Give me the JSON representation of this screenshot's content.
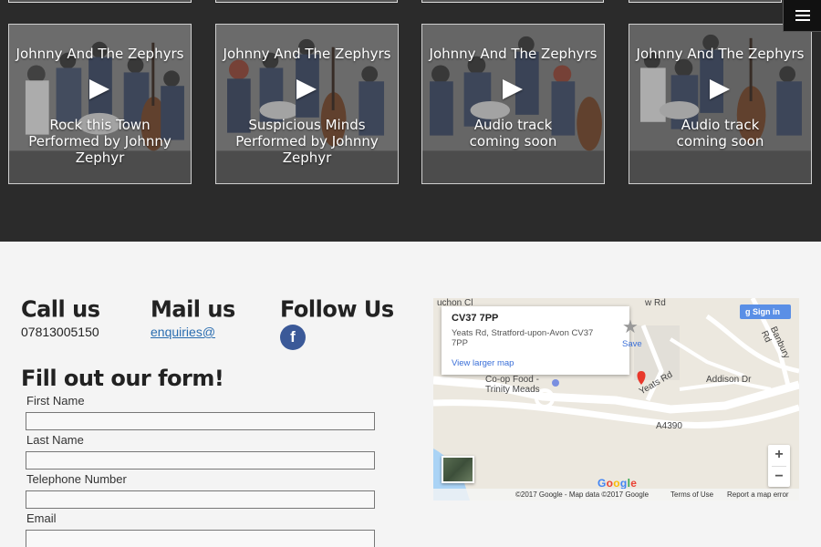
{
  "menu": {
    "icon": "hamburger-icon"
  },
  "tracks": [
    {
      "band": "Johnny And The Zephyrs",
      "caption": "Rock this Town Performed by Johnny Zephyr",
      "icon": "play-icon"
    },
    {
      "band": "Johnny And The Zephyrs",
      "caption": "Suspicious Minds Performed by Johnny Zephyr",
      "icon": "play-icon"
    },
    {
      "band": "Johnny And The Zephyrs",
      "caption": "Audio track coming soon",
      "icon": "play-icon"
    },
    {
      "band": "Johnny And The Zephyrs",
      "caption": "Audio track coming soon",
      "icon": "play-icon"
    }
  ],
  "contact": {
    "call": {
      "heading": "Call us",
      "phone": "07813005150"
    },
    "mail": {
      "heading": "Mail us",
      "email": "enquiries@"
    },
    "follow": {
      "heading": "Follow Us",
      "facebook": "f",
      "icon": "facebook-icon"
    }
  },
  "form": {
    "title": "Fill out our form!",
    "fields": [
      {
        "label": "First Name",
        "value": ""
      },
      {
        "label": "Last Name",
        "value": ""
      },
      {
        "label": "Telephone Number",
        "value": ""
      },
      {
        "label": "Email",
        "value": ""
      }
    ]
  },
  "map": {
    "place": "CV37 7PP",
    "address": "Yeats Rd, Stratford-upon-Avon CV37 7PP",
    "larger_link": "View larger map",
    "save": "Save",
    "signin": "Sign in",
    "zoom_in": "+",
    "zoom_out": "−",
    "logo": "Google",
    "labels": {
      "coop": "Co-op Food -",
      "trinity": "Trinity Meads",
      "yeats": "Yeats Rd",
      "addison": "Addison Dr",
      "a4390": "A4390",
      "banbury": "Banbury Rd",
      "rd": "w Rd",
      "cl": "uchon Cl"
    },
    "footer": {
      "copyright": "©2017 Google - Map data ©2017 Google",
      "terms": "Terms of Use",
      "report": "Report a map error"
    },
    "colors": {
      "road": "#ffffff",
      "land": "#ece8df",
      "water": "#aad3f5",
      "pin": "#e8382b"
    }
  }
}
